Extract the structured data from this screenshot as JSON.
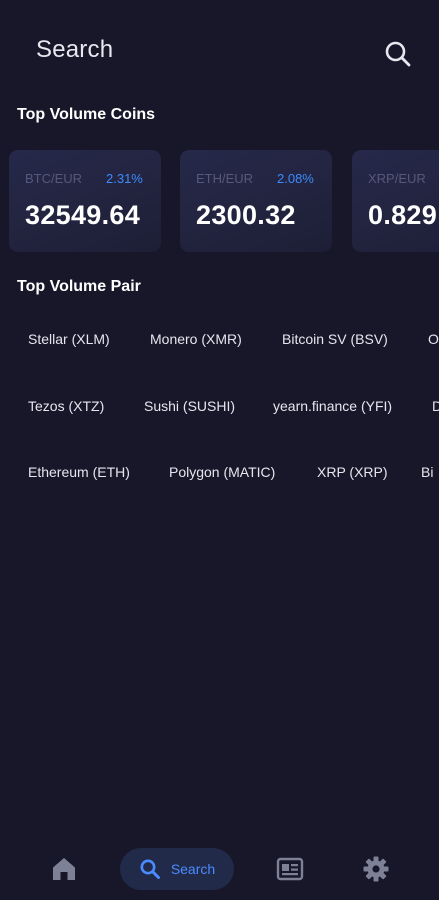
{
  "header": {
    "title": "Search",
    "search_icon": "search-icon"
  },
  "sections": {
    "coins_title": "Top Volume Coins",
    "pairs_title": "Top Volume Pair"
  },
  "coins": [
    {
      "pair": "BTC/EUR",
      "change": "2.31%",
      "price": "32549.64"
    },
    {
      "pair": "ETH/EUR",
      "change": "2.08%",
      "price": "2300.32"
    },
    {
      "pair": "XRP/EUR",
      "change": "",
      "price": "0.829"
    }
  ],
  "pairs": [
    [
      "Stellar (XLM)",
      "Monero (XMR)",
      "Bitcoin SV (BSV)",
      "O"
    ],
    [
      "Tezos (XTZ)",
      "Sushi (SUSHI)",
      "yearn.finance (YFI)",
      "D"
    ],
    [
      "Ethereum (ETH)",
      "Polygon (MATIC)",
      "XRP (XRP)",
      "Bi"
    ]
  ],
  "nav": {
    "home_icon": "home-icon",
    "search_label": "Search",
    "news_icon": "news-icon",
    "settings_icon": "gear-icon"
  },
  "colors": {
    "background": "#171729",
    "card": "#23253f",
    "accent": "#3d8bff",
    "muted": "#56597c",
    "nav_active_bg": "#222a4a"
  }
}
